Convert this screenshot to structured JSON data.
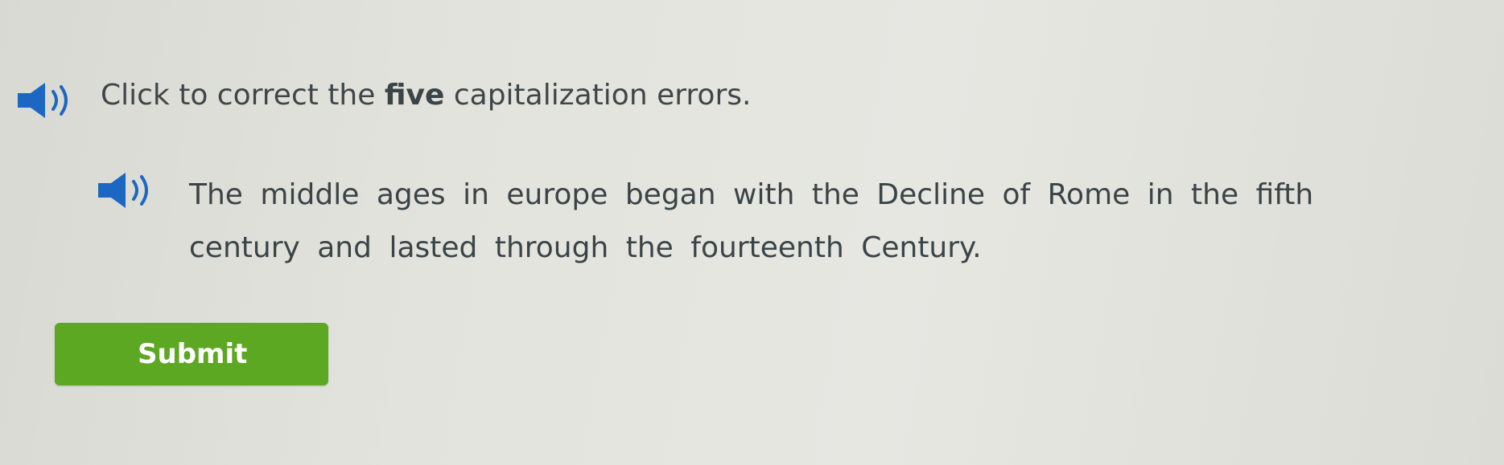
{
  "instruction": {
    "prefix": "Click to correct the ",
    "emphasis": "five",
    "suffix": " capitalization errors."
  },
  "sentence": {
    "line1": [
      "The",
      "middle",
      "ages",
      "in",
      "europe",
      "began",
      "with",
      "the",
      "Decline",
      "of",
      "Rome",
      "in",
      "the",
      "fifth"
    ],
    "line2": [
      "century",
      "and",
      "lasted",
      "through",
      "the",
      "fourteenth",
      "Century."
    ]
  },
  "submit_label": "Submit",
  "icons": {
    "instruction_audio": "speaker-icon",
    "sentence_audio": "speaker-icon"
  },
  "colors": {
    "speaker_icon": "#1c67c2",
    "submit_button": "#5da823",
    "text": "#3d4749"
  }
}
